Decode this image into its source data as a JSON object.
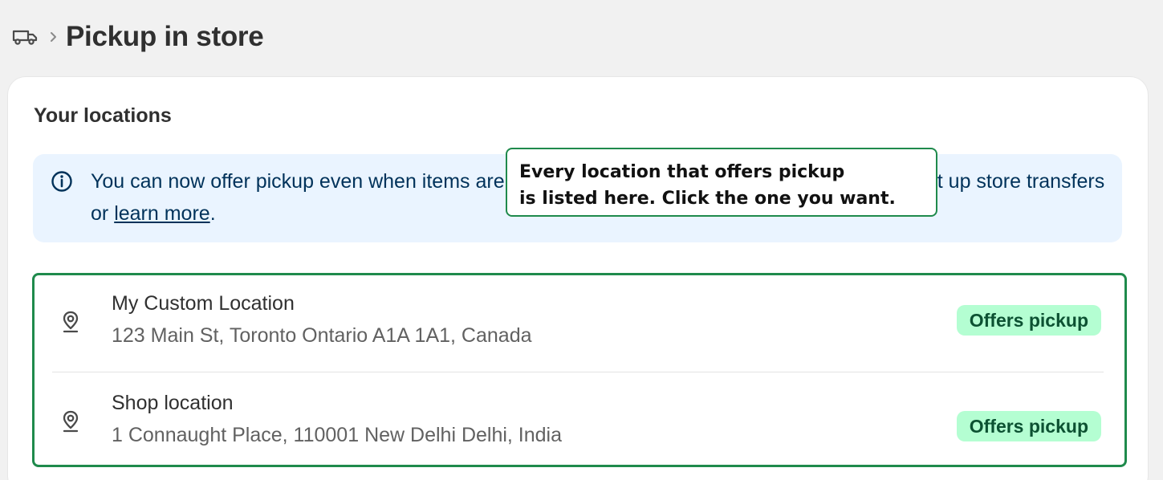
{
  "header": {
    "icon": "truck-icon",
    "separator_icon": "chevron-right-icon",
    "title": "Pickup in store"
  },
  "card": {
    "title": "Your locations",
    "banner": {
      "icon": "info-icon",
      "text_before": "You can now offer pickup even when items are out of stock at your store. Select a location to set up store transfers or ",
      "link_text": "learn more",
      "text_after": "."
    },
    "locations": [
      {
        "icon": "location-pin-icon",
        "name": "My Custom Location",
        "address": "123 Main St, Toronto Ontario A1A 1A1, Canada",
        "badge": "Offers pickup"
      },
      {
        "icon": "location-pin-icon",
        "name": "Shop location",
        "address": "1 Connaught Place, 110001 New Delhi Delhi, India",
        "badge": "Offers pickup"
      }
    ]
  },
  "annotation": {
    "text": "Every location that offers pickup\nis listed here. Click the one you want."
  },
  "colors": {
    "background": "#f1f1f1",
    "banner_bg": "#eaf4ff",
    "badge_bg": "#b4fed2",
    "badge_text": "#0c5132",
    "annotation_border": "#1f8a4c"
  }
}
